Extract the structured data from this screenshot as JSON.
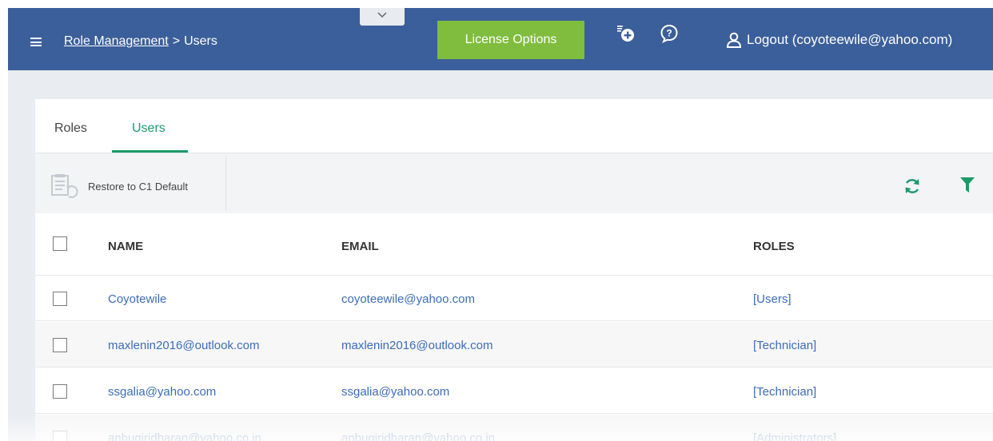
{
  "header": {
    "breadcrumb_parent": "Role Management",
    "breadcrumb_separator": ">",
    "breadcrumb_current": "Users",
    "license_button": "License Options",
    "logout_label": "Logout (coyoteewile@yahoo.com)"
  },
  "tabs": [
    {
      "label": "Roles"
    },
    {
      "label": "Users"
    }
  ],
  "toolbar": {
    "restore_label": "Restore to C1 Default"
  },
  "table": {
    "columns": [
      "NAME",
      "EMAIL",
      "ROLES"
    ],
    "rows": [
      {
        "name": "Coyotewile",
        "email": "coyoteewile@yahoo.com",
        "roles": "[Users]"
      },
      {
        "name": "maxlenin2016@outlook.com",
        "email": "maxlenin2016@outlook.com",
        "roles": "[Technician]"
      },
      {
        "name": "ssgalia@yahoo.com",
        "email": "ssgalia@yahoo.com",
        "roles": "[Technician]"
      },
      {
        "name": "anbugiridharan@yahoo.co.in",
        "email": "anbugiridharan@yahoo.co.in",
        "roles": "[Administrators]"
      }
    ]
  },
  "colors": {
    "header_bg": "#3b5f9a",
    "license_green": "#80bd3e",
    "accent_green": "#1b9a6a",
    "link_blue": "#3c6cb8"
  },
  "icons": [
    "hamburger-icon",
    "chevron-down-icon",
    "add-device-icon",
    "help-icon",
    "user-icon",
    "restore-icon",
    "refresh-icon",
    "filter-icon"
  ]
}
